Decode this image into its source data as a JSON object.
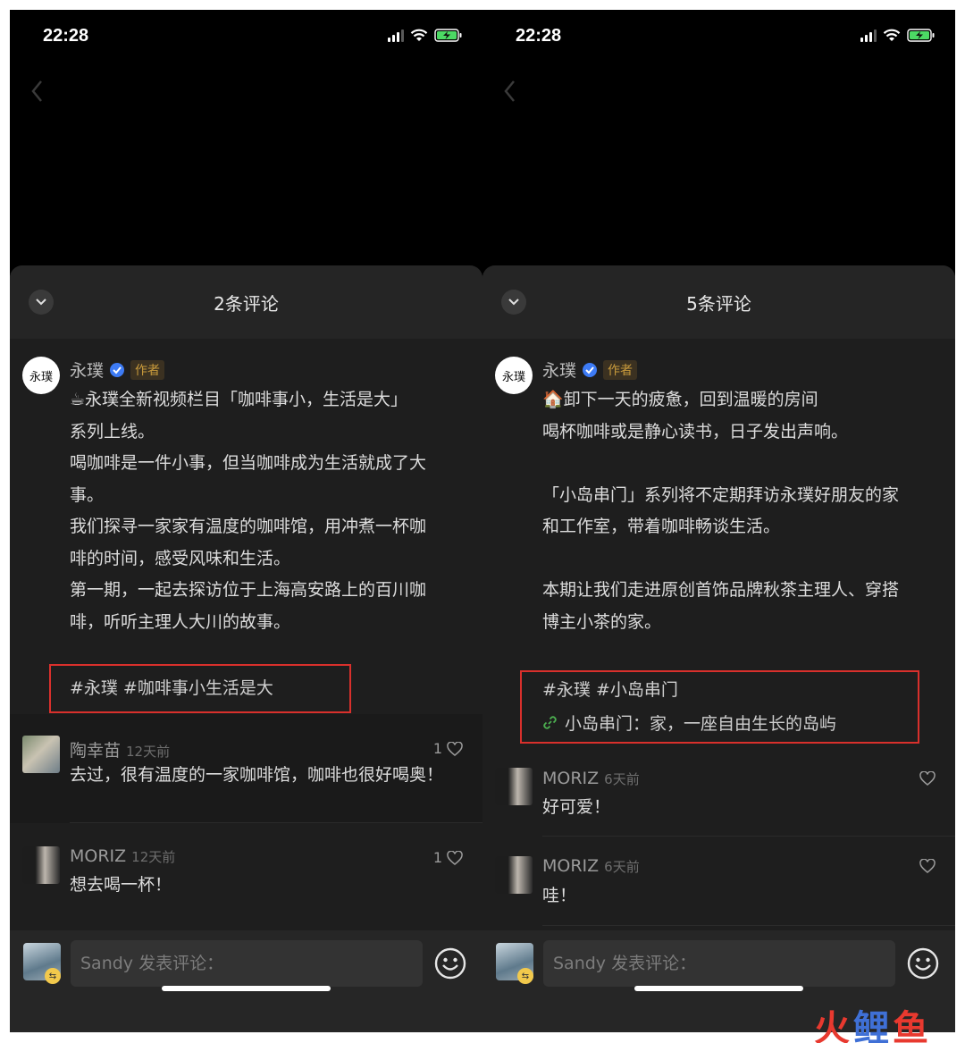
{
  "left": {
    "time": "22:28",
    "title": "2条评论",
    "author": {
      "name": "永璞",
      "badge": "作者",
      "avatar_text": "永璞"
    },
    "post_lines": [
      "☕永璞全新视频栏目「咖啡事小，生活是大」",
      "系列上线。",
      "喝咖啡是一件小事，但当咖啡成为生活就成了大",
      "事。",
      "我们探寻一家家有温度的咖啡馆，用冲煮一杯咖",
      "啡的时间，感受风味和生活。",
      "第一期，一起去探访位于上海高安路上的百川咖",
      "啡，听听主理人大川的故事。"
    ],
    "hashtags": [
      "#永璞",
      "#咖啡事小生活是大"
    ],
    "replies": [
      {
        "name": "陶幸苗",
        "time": "12天前",
        "likes": "1",
        "text": "去过，很有温度的一家咖啡馆，咖啡也很好喝奥！"
      },
      {
        "name": "MORIZ",
        "time": "12天前",
        "likes": "1",
        "text": "想去喝一杯！"
      }
    ],
    "input_placeholder": "Sandy 发表评论："
  },
  "right": {
    "time": "22:28",
    "title": "5条评论",
    "author": {
      "name": "永璞",
      "badge": "作者",
      "avatar_text": "永璞"
    },
    "post_lines": [
      "🏠卸下一天的疲惫，回到温暖的房间",
      "喝杯咖啡或是静心读书，日子发出声响。",
      "",
      "「小岛串门」系列将不定期拜访永璞好朋友的家",
      "和工作室，带着咖啡畅谈生活。",
      "",
      "本期让我们走进原创首饰品牌秋茶主理人、穿搭",
      "博主小茶的家。"
    ],
    "hashtags": [
      "#永璞",
      "#小岛串门"
    ],
    "link_text": "小岛串门：家，一座自由生长的岛屿",
    "replies": [
      {
        "name": "MORIZ",
        "time": "6天前",
        "likes": "",
        "text": "好可爱！"
      },
      {
        "name": "MORIZ",
        "time": "6天前",
        "likes": "",
        "text": "哇！"
      }
    ],
    "input_placeholder": "Sandy 发表评论："
  },
  "watermark": [
    "火",
    "鲤",
    "鱼"
  ],
  "colors": {
    "highlight_box": "#d9302c",
    "verified": "#3d7bf5",
    "badge_text": "#c89a3c"
  }
}
